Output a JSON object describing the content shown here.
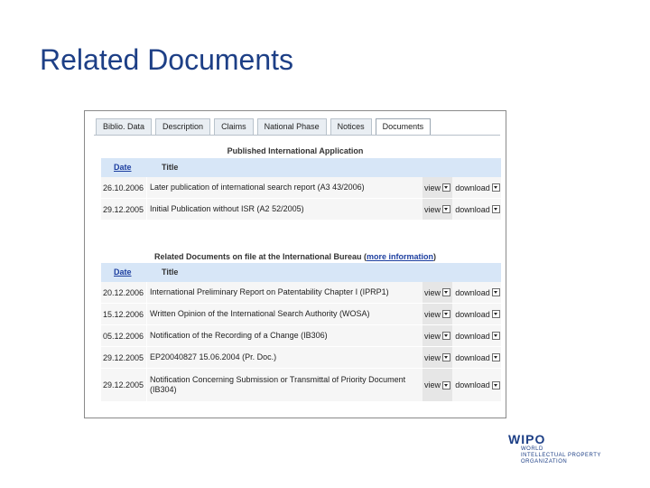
{
  "slide": {
    "title": "Related Documents"
  },
  "tabs": [
    {
      "label": "Biblio. Data",
      "active": false
    },
    {
      "label": "Description",
      "active": false
    },
    {
      "label": "Claims",
      "active": false
    },
    {
      "label": "National Phase",
      "active": false
    },
    {
      "label": "Notices",
      "active": false
    },
    {
      "label": "Documents",
      "active": true
    }
  ],
  "published": {
    "heading": "Published International Application",
    "col_date": "Date",
    "col_title": "Title",
    "rows": [
      {
        "date": "26.10.2006",
        "title": "Later publication of international search report (A3 43/2006)",
        "view": "view",
        "download": "download"
      },
      {
        "date": "29.12.2005",
        "title": "Initial Publication without ISR (A2 52/2005)",
        "view": "view",
        "download": "download"
      }
    ]
  },
  "related": {
    "heading": "Related Documents on file at the International Bureau",
    "link_prefix": "(",
    "link": "more information",
    "link_suffix": ")",
    "col_date": "Date",
    "col_title": "Title",
    "rows": [
      {
        "date": "20.12.2006",
        "title": "International Preliminary Report on Patentability Chapter I (IPRP1)",
        "view": "view",
        "download": "download"
      },
      {
        "date": "15.12.2006",
        "title": "Written Opinion of the International Search Authority (WOSA)",
        "view": "view",
        "download": "download"
      },
      {
        "date": "05.12.2006",
        "title": "Notification of the Recording of a Change (IB306)",
        "view": "view",
        "download": "download"
      },
      {
        "date": "29.12.2005",
        "title": "EP20040827 15.06.2004 (Pr. Doc.)",
        "view": "view",
        "download": "download"
      },
      {
        "date": "29.12.2005",
        "title": "Notification Concerning Submission or Transmittal of Priority Document (IB304)",
        "view": "view",
        "download": "download"
      }
    ]
  },
  "logo": {
    "word": "WIPO",
    "line1": "WORLD",
    "line2": "INTELLECTUAL PROPERTY",
    "line3": "ORGANIZATION"
  }
}
